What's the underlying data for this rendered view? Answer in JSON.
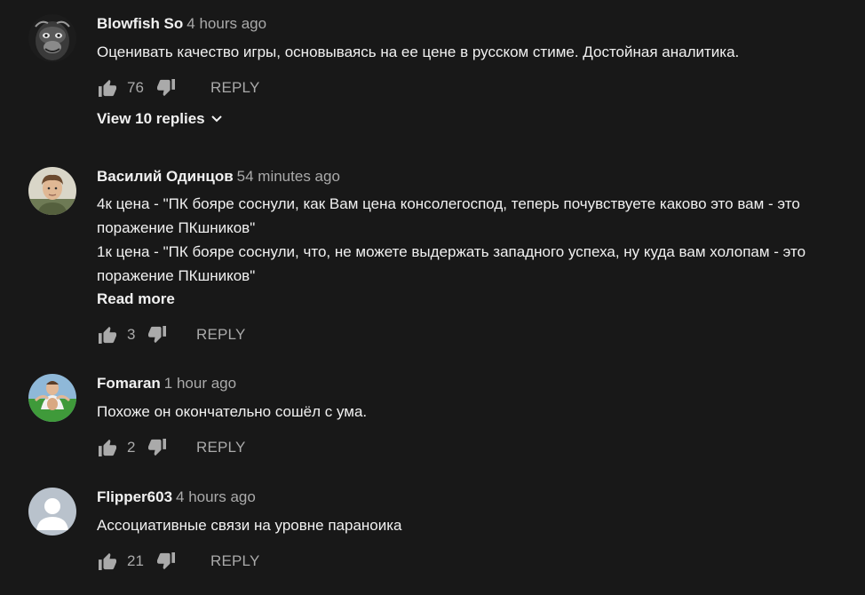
{
  "comments": [
    {
      "author": "Blowfish So",
      "time": "4 hours ago",
      "text": "Оценивать качество игры, основываясь на ее цене в русском стиме. Достойная аналитика.",
      "likes": "76",
      "reply_label": "REPLY",
      "view_replies": "View 10 replies",
      "avatar_icon": "gorilla-avatar"
    },
    {
      "author": "Василий Одинцов",
      "time": "54 minutes ago",
      "text": "4к цена - \"ПК бояре соснули, как Вам цена консолегоспод, теперь почувствуете каково это вам - это поражение ПКшников\"\n1к цена - \"ПК бояре соснули, что, не можете выдержать западного успеха, ну куда вам холопам - это поражение ПКшников\"",
      "read_more": "Read more",
      "likes": "3",
      "reply_label": "REPLY",
      "avatar_icon": "photo-avatar"
    },
    {
      "author": "Fomaran",
      "time": "1 hour ago",
      "text": "Похоже он окончательно сошёл с ума.",
      "likes": "2",
      "reply_label": "REPLY",
      "avatar_icon": "photo-avatar-green"
    },
    {
      "author": "Flipper603",
      "time": "4 hours ago",
      "text": "Ассоциативные связи на уровне параноика",
      "likes": "21",
      "reply_label": "REPLY",
      "avatar_icon": "default-user-avatar"
    }
  ],
  "colors": {
    "background": "#181818",
    "text": "#f1f1f1",
    "secondary": "#aaaaaa"
  }
}
